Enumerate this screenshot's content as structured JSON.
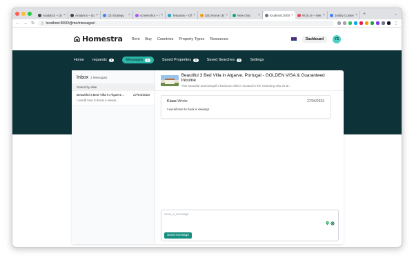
{
  "browser": {
    "tabs": [
      {
        "title": "Analytics – Daci",
        "fav": "#444444"
      },
      {
        "title": "Analytics – Daci",
        "fav": "#444444"
      },
      {
        "title": "(3) Strategy",
        "fav": "#3b82f6"
      },
      {
        "title": "screenshot – Go",
        "fav": "#a855f7"
      },
      {
        "title": "Testanas – Offic",
        "fav": "#22a3c4"
      },
      {
        "title": "(34) Home | Boo",
        "fav": "#f59e0b"
      },
      {
        "title": "New chat",
        "fav": "#10a37f"
      },
      {
        "title": "localhost:3000/",
        "fav": "#6b7280"
      },
      {
        "title": "NOS.nl – Nieuw",
        "fav": "#ef4444"
      },
      {
        "title": "Justify Content",
        "fav": "#3b82f6"
      }
    ],
    "active_tab": 7,
    "url": "localhost:3000/@me/messages/",
    "extension_colors": [
      "#9ca3af",
      "#9ca3af",
      "#22c55e",
      "#0ea5e9",
      "#e11d48",
      "#f59e0b",
      "#16a34a",
      "#7c3aed",
      "#6b7280",
      "#111827"
    ]
  },
  "header": {
    "brand": "Homestra",
    "nav": [
      "Rent",
      "Buy",
      "Countries",
      "Property Types",
      "Resources"
    ],
    "dashboard_label": "Dashboard",
    "avatar_initials": "YE"
  },
  "subnav": [
    {
      "label": "Home",
      "count": null
    },
    {
      "label": "requests",
      "count": "1"
    },
    {
      "label": "Messages",
      "count": "1",
      "active": true
    },
    {
      "label": "Saved Properties",
      "count": "0"
    },
    {
      "label": "Saved Searches",
      "count": "0"
    },
    {
      "label": "Settings",
      "count": null
    }
  ],
  "inbox": {
    "title": "Inbox",
    "count_label": "1 Messages",
    "sorted_label": "Sorted by date",
    "conversations": [
      {
        "title": "Beautiful 3 Bed Villa in Algarve...",
        "date": "27/04/2023",
        "preview": "I would love to book a viewin..."
      }
    ]
  },
  "thread": {
    "property_title": "Beautiful 3 Bed Villa in Algarve, Portugal - GOLDEN VISA & Guaranteed Income",
    "property_desc": "This beautiful and tranquil 3 bedroom villa is located in the charming Vila do Bi...",
    "message": {
      "sender": "Kiaas",
      "verb": "Wrote",
      "date": "27/04/2023",
      "body": "I would love to book a viewing!"
    },
    "composer_placeholder": "send_a_message",
    "send_label": "Send message"
  },
  "colors": {
    "band": "#0d3339",
    "accent": "#2bb8a8",
    "send_button": "#168f80"
  }
}
